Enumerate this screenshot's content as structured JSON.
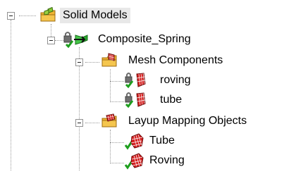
{
  "tree": {
    "root": {
      "label": "Solid Models",
      "icon": "folder-model-icon",
      "children": [
        {
          "label": "Composite_Spring",
          "icon": "locked-composite-icon",
          "children": [
            {
              "label": "Mesh Components",
              "icon": "folder-mesh-icon",
              "children": [
                {
                  "label": "roving",
                  "icon": "locked-mesh-part-icon"
                },
                {
                  "label": "tube",
                  "icon": "locked-mesh-part-icon"
                }
              ]
            },
            {
              "label": "Layup Mapping Objects",
              "icon": "folder-layup-icon",
              "children": [
                {
                  "label": "Tube",
                  "icon": "layup-object-icon"
                },
                {
                  "label": "Roving",
                  "icon": "layup-object-icon"
                }
              ]
            }
          ]
        }
      ]
    }
  }
}
